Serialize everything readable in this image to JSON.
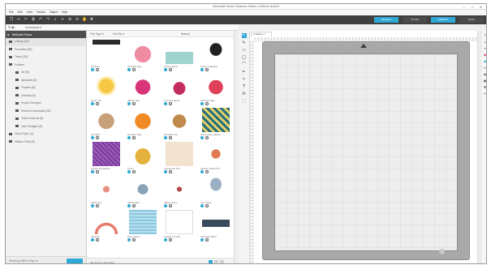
{
  "window": {
    "title": "Silhouette Studio: Business Edition: untitled1.studio3",
    "controls": "— □ ✕"
  },
  "menu": [
    "File",
    "Edit",
    "View",
    "Panels",
    "Object",
    "Help"
  ],
  "toolbar": {
    "tools": [
      "❐",
      "⎓",
      "✂",
      "⧉",
      "↶",
      "↷",
      "⌕",
      "⌖",
      "⊕",
      "⊖",
      "✋",
      "✥"
    ],
    "tabs": [
      {
        "label": "DESIGN",
        "active": true
      },
      {
        "label": "STORE",
        "active": false
      },
      {
        "label": "LIBRARY",
        "active": true
      },
      {
        "label": "SEND",
        "active": false
      }
    ]
  },
  "subbar": {
    "view": "☰ ▦ ↓",
    "sort": "Downloads ▾",
    "filter": "File Type ▾",
    "sort2": "Sort By ▾",
    "search": "Search"
  },
  "library": {
    "header": "Melodie Rose",
    "items": [
      {
        "label": "Library (52)",
        "level": 0,
        "selected": true
      },
      {
        "label": "Favorites (84)",
        "level": 0,
        "selected": false
      },
      {
        "label": "Trash (30)",
        "level": 0,
        "selected": false
      },
      {
        "label": "Folders",
        "level": 0,
        "selected": false
      },
      {
        "label": "Art (8)",
        "level": 1,
        "selected": false
      },
      {
        "label": "Alphabet (6)",
        "level": 1,
        "selected": false
      },
      {
        "label": "Flowers (8)",
        "level": 1,
        "selected": false
      },
      {
        "label": "Animals (6)",
        "level": 1,
        "selected": false
      },
      {
        "label": "Project Designs",
        "level": 1,
        "selected": false
      },
      {
        "label": "Recent Downloads (28)",
        "level": 1,
        "selected": false
      },
      {
        "label": "Travel Journal (6)",
        "level": 1,
        "selected": false
      },
      {
        "label": "User Designs (6)",
        "level": 1,
        "selected": false
      },
      {
        "label": "Cloud Sync (4)",
        "level": 0,
        "selected": false
      },
      {
        "label": "Hidden Files (8)",
        "level": 0,
        "selected": false
      }
    ],
    "signin": "Working Offline Sign In",
    "button": "Go"
  },
  "content": {
    "footer_count": "597 items in this folder",
    "items": [
      {
        "label": "pinstripe",
        "icon": "stencil-thumb"
      },
      {
        "label": "cupcake bag",
        "icon": "bag-thumb"
      },
      {
        "label": "pretty squad",
        "icon": "teal-shape-thumb"
      },
      {
        "label": "pretty mustache",
        "icon": "mustache-thumb"
      },
      {
        "label": "pretty sun",
        "icon": "sun-thumb"
      },
      {
        "label": "giftpop bag",
        "icon": "pink-bag-thumb"
      },
      {
        "label": "princess decor",
        "icon": "princess-thumb"
      },
      {
        "label": "princess bag",
        "icon": "princess-bag-thumb"
      },
      {
        "label": "pumpkin",
        "icon": "pumpkin-thumb"
      },
      {
        "label": "pumpkin bag",
        "icon": "pumpkin-bag-thumb"
      },
      {
        "label": "pumpkin box",
        "icon": "box-thumb"
      },
      {
        "label": "purse party pattern",
        "icon": "pattern-thumb"
      },
      {
        "label": "purple dot fashion",
        "icon": "purple-pattern-thumb"
      },
      {
        "label": "purse",
        "icon": "purse-thumb"
      },
      {
        "label": "quarantine 5x7",
        "icon": "quarantine-thumb"
      },
      {
        "label": "quarter hearts 5x7",
        "icon": "heart-thumb"
      },
      {
        "label": "rabbit tag",
        "icon": "rabbit-thumb"
      },
      {
        "label": "rabbit pack",
        "icon": "tag-thumb"
      },
      {
        "label": "rabbit string",
        "icon": "rabbit-string-thumb"
      },
      {
        "label": "rain cloud",
        "icon": "cloud-thumb"
      },
      {
        "label": "rainbow",
        "icon": "rainbow-thumb"
      },
      {
        "label": "blue pattern",
        "icon": "blue-pattern-thumb"
      },
      {
        "label": "raising my tribe",
        "icon": "tribe-thumb"
      },
      {
        "label": "rectangle label",
        "icon": "label-thumb"
      }
    ]
  },
  "doc_tab": "Untitled-1 ×",
  "sidetools": [
    "↖",
    "✎",
    "▭",
    "◯",
    "⌒",
    "✏",
    "✑",
    "T",
    "✉",
    "⬚"
  ],
  "right_strip": [
    "↑",
    "↓",
    "≡",
    "◆",
    "◆",
    "✏",
    "◉",
    "▣",
    "⦾",
    "✍"
  ],
  "colors": {
    "accent": "#2ea9d6",
    "toolbar": "#3f3f3f",
    "mat": "#a9a9a9"
  }
}
